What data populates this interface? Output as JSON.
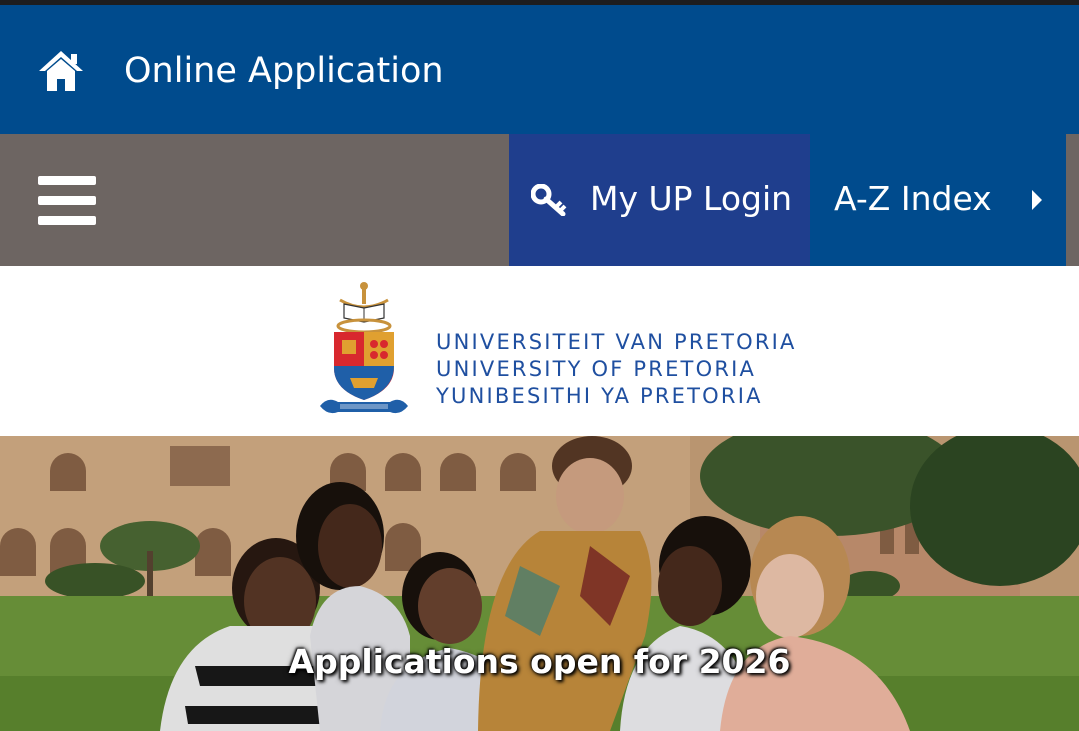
{
  "header": {
    "home_icon": "home-icon",
    "title": "Online Application"
  },
  "navbar": {
    "menu_icon": "hamburger-menu-icon",
    "login": {
      "icon": "key-icon",
      "label": "My UP Login"
    },
    "az_index": {
      "label": "A-Z Index",
      "icon": "caret-right-icon"
    }
  },
  "logo": {
    "lines": [
      "UNIVERSITEIT VAN PRETORIA",
      "UNIVERSITY OF PRETORIA",
      "YUNIBESITHI YA PRETORIA"
    ],
    "motto_scroll": "ETLTINGVEN ET INTVRIRE PROSEQUA"
  },
  "hero": {
    "caption": "Applications open for 2026"
  },
  "colors": {
    "header_bg": "#004b8d",
    "nav_bg": "#6d6562",
    "login_bg": "#1f3e8d",
    "logo_text": "#1f4fa0"
  }
}
